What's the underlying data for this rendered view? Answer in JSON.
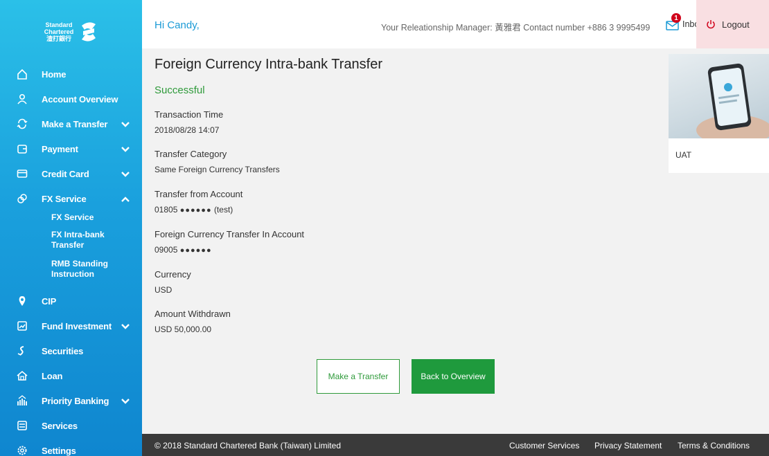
{
  "logo": {
    "line1": "Standard",
    "line2": "Chartered",
    "line3": "渣打銀行"
  },
  "sidebar": {
    "items": [
      {
        "label": "Home",
        "icon": "home-icon"
      },
      {
        "label": "Account Overview",
        "icon": "user-icon"
      },
      {
        "label": "Make a Transfer",
        "icon": "transfer-icon"
      },
      {
        "label": "Payment",
        "icon": "payment-icon"
      },
      {
        "label": "Credit Card",
        "icon": "credit-card-icon"
      },
      {
        "label": "FX Service",
        "icon": "fx-icon"
      },
      {
        "label": "CIP",
        "icon": "cip-icon"
      },
      {
        "label": "Fund Investment",
        "icon": "fund-icon"
      },
      {
        "label": "Securities",
        "icon": "securities-icon"
      },
      {
        "label": "Loan",
        "icon": "loan-icon"
      },
      {
        "label": "Priority Banking",
        "icon": "priority-icon"
      },
      {
        "label": "Services",
        "icon": "services-icon"
      },
      {
        "label": "Settings",
        "icon": "settings-icon"
      }
    ],
    "fx_sub": [
      {
        "label": "FX Service"
      },
      {
        "label": "FX Intra-bank Transfer"
      },
      {
        "label": "RMB Standing Instruction"
      }
    ]
  },
  "header": {
    "greeting": "Hi Candy,",
    "rm_info": "Your Releationship Manager: 黃雅君 Contact number +886 3 9995499",
    "inbox_label": "Inbox",
    "inbox_count": "1",
    "logout_label": "Logout"
  },
  "main": {
    "title": "Foreign Currency Intra-bank Transfer",
    "status": "Successful",
    "fields": [
      {
        "label": "Transaction Time",
        "value": "2018/08/28 14:07"
      },
      {
        "label": "Transfer Category",
        "value": "Same Foreign Currency Transfers"
      },
      {
        "label": "Transfer from Account",
        "value": "01805",
        "mask": "●●●●●●",
        "suffix": "(test)"
      },
      {
        "label": "Foreign Currency Transfer In Account",
        "value": "09005",
        "mask": "●●●●●●",
        "suffix": ""
      },
      {
        "label": "Currency",
        "value": "USD"
      },
      {
        "label": "Amount Withdrawn",
        "value": "USD 50,000.00"
      }
    ],
    "buttons": {
      "make_transfer": "Make a Transfer",
      "back_overview": "Back to Overview"
    }
  },
  "promo": {
    "label": "UAT"
  },
  "footer": {
    "copyright": "© 2018 Standard Chartered Bank (Taiwan) Limited",
    "links": [
      "Customer Services",
      "Privacy Statement",
      "Terms & Conditions"
    ]
  },
  "colors": {
    "accent": "#1a9ad6",
    "success": "#2e9a3a",
    "primary_button": "#1f9a3d",
    "logout_bg": "#f9dfe2",
    "footer_bg": "#3a3a3a"
  }
}
